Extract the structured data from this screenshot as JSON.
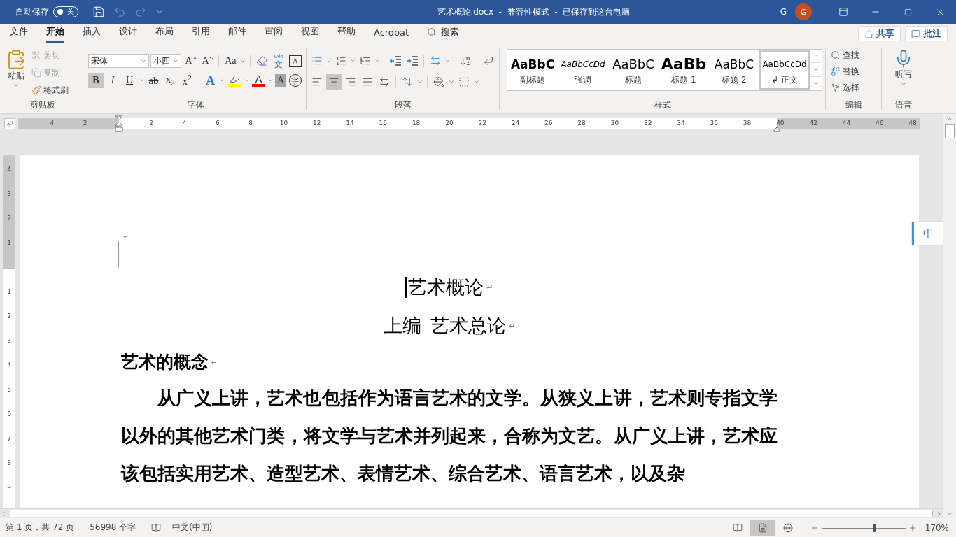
{
  "title_bar": {
    "autosave_label": "自动保存",
    "autosave_on": false,
    "autosave_state": "关",
    "title": "艺术概论.docx  -  兼容性模式  -  已保存到这台电脑",
    "user_name": "G",
    "avatar_initial": "G"
  },
  "menu_tabs": [
    {
      "label": "文件",
      "selected": false
    },
    {
      "label": "开始",
      "selected": true
    },
    {
      "label": "插入",
      "selected": false
    },
    {
      "label": "设计",
      "selected": false
    },
    {
      "label": "布局",
      "selected": false
    },
    {
      "label": "引用",
      "selected": false
    },
    {
      "label": "邮件",
      "selected": false
    },
    {
      "label": "审阅",
      "selected": false
    },
    {
      "label": "视图",
      "selected": false
    },
    {
      "label": "帮助",
      "selected": false
    },
    {
      "label": "Acrobat",
      "selected": false
    }
  ],
  "search_label": "搜索",
  "share_button": "共享",
  "comment_button": "批注",
  "clipboard": {
    "paste": "粘贴",
    "group_label": "剪贴板",
    "items": [
      {
        "kind": "cut",
        "label": "剪切",
        "disabled": true
      },
      {
        "kind": "copy",
        "label": "复制",
        "disabled": true
      },
      {
        "kind": "format_painter",
        "label": "格式刷",
        "disabled": false
      }
    ]
  },
  "font": {
    "font_name": "宋体",
    "font_size": "小四",
    "group_label": "字体",
    "tools": [
      {
        "kind": "grow",
        "label": "A"
      },
      {
        "kind": "shrink",
        "label": "A"
      },
      {
        "kind": "case",
        "label": "Aa"
      },
      {
        "kind": "clear"
      },
      {
        "kind": "phonetic",
        "label": "文",
        "ruby": "wén"
      },
      {
        "kind": "border",
        "label": "A"
      }
    ],
    "format_buttons": [
      {
        "kind": "bold",
        "label": "B",
        "selected": true
      },
      {
        "kind": "italic",
        "label": "I",
        "selected": false
      },
      {
        "kind": "underline",
        "label": "U",
        "selected": false
      },
      {
        "kind": "strike",
        "label": "ab",
        "selected": false
      },
      {
        "kind": "subscript",
        "label": "x$_{2}$",
        "selected": false
      },
      {
        "kind": "superscript",
        "label": "x$^{2}$",
        "selected": false
      }
    ],
    "effect_buttons": [
      {
        "kind": "effects",
        "label": "A"
      },
      {
        "kind": "highlight",
        "color": "#ffff00"
      },
      {
        "kind": "font_color",
        "label": "A",
        "color": "#ff0000"
      },
      {
        "kind": "shading",
        "label": "A"
      },
      {
        "kind": "enclose",
        "label": "字"
      }
    ]
  },
  "paragraph": {
    "group_label": "段落",
    "alignments": [
      {
        "kind": "left",
        "selected": false
      },
      {
        "kind": "center",
        "selected": true
      },
      {
        "kind": "right",
        "selected": false
      },
      {
        "kind": "justify",
        "selected": false
      },
      {
        "kind": "distributed",
        "selected": false
      }
    ]
  },
  "styles": {
    "group_label": "样式",
    "items": [
      {
        "kind": "subtitle",
        "preview": "AaBbC",
        "label": "副标题",
        "selected": false
      },
      {
        "kind": "emphasis",
        "preview": "AaBbCcDd",
        "label": "强调",
        "selected": false
      },
      {
        "kind": "title",
        "preview": "AaBbC",
        "label": "标题",
        "selected": false
      },
      {
        "kind": "heading1",
        "preview": "AaBb",
        "label": "标题 1",
        "selected": false
      },
      {
        "kind": "heading2",
        "preview": "AaBbC",
        "label": "标题 2",
        "selected": false
      },
      {
        "kind": "normal",
        "preview": "AaBbCcDd",
        "label": "正文",
        "mark": "↲",
        "selected": true
      }
    ]
  },
  "editing": {
    "group_label": "编辑",
    "items": [
      {
        "kind": "find",
        "label": "查找"
      },
      {
        "kind": "replace",
        "label": "替换"
      },
      {
        "kind": "select",
        "label": "选择"
      }
    ]
  },
  "voice": {
    "group_label": "语音",
    "dictate": "听写"
  },
  "ruler": {
    "left_labels": [
      "4",
      "2"
    ],
    "body_labels": [
      "2",
      "4",
      "6",
      "8",
      "10",
      "12",
      "14",
      "16",
      "18",
      "20",
      "22",
      "24",
      "26",
      "28",
      "30",
      "32",
      "34",
      "36",
      "38"
    ],
    "right_labels": [
      "40",
      "42",
      "44",
      "46",
      "48"
    ]
  },
  "vertical_ruler": {
    "top_labels": [
      "4",
      "3",
      "2",
      "1"
    ],
    "body_labels": [
      "1",
      "2",
      "3",
      "4",
      "5",
      "6",
      "7",
      "8",
      "9"
    ]
  },
  "document": {
    "empty_mark": "↵",
    "title": {
      "text": "艺术概论",
      "mark": "↵"
    },
    "subtitle": {
      "text": "上编  艺术总论",
      "mark": "↵"
    },
    "heading": {
      "text": "艺术的概念",
      "mark": "↵"
    },
    "body": "从广义上讲，艺术也包括作为语言艺术的文学。从狭义上讲，艺术则专指文学以外的其他艺术门类，将文学与艺术并列起来，合称为文艺。从广义上讲，艺术应该包括实用艺术、造型艺术、表情艺术、综合艺术、语言艺术，以及杂"
  },
  "ime_indicator": "中",
  "status_bar": {
    "page": "第 1 页，共 72 页",
    "words": "56998 个字",
    "language": "中文(中国)",
    "views": [
      {
        "kind": "read",
        "selected": false
      },
      {
        "kind": "print",
        "selected": true
      },
      {
        "kind": "web",
        "selected": false
      }
    ],
    "zoom": {
      "level": 0.63,
      "reading": "170%"
    }
  }
}
